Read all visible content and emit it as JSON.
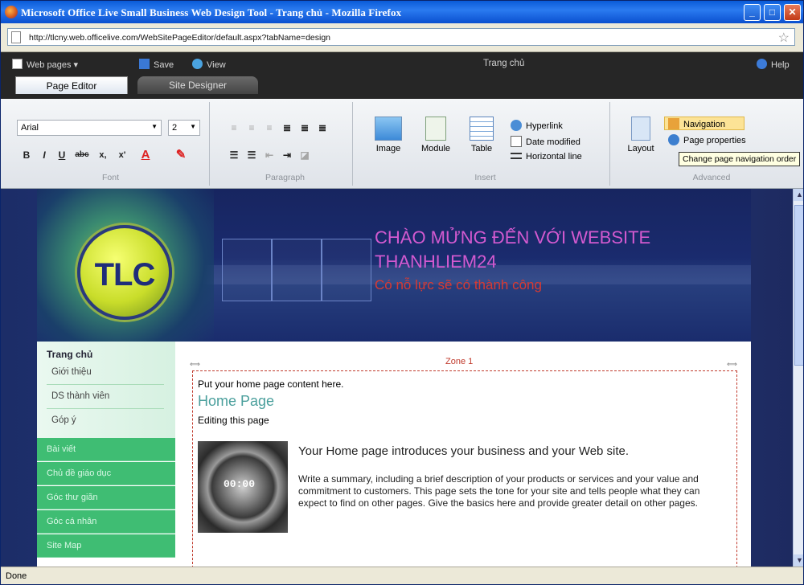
{
  "window": {
    "title": "Microsoft Office Live Small Business Web Design Tool - Trang chủ - Mozilla Firefox",
    "minimize": "_",
    "maximize": "□",
    "close": "✕"
  },
  "address": {
    "url": "http://tlcny.web.officelive.com/WebSitePageEditor/default.aspx?tabName=design",
    "star": "☆"
  },
  "toolbar": {
    "web_pages": "Web pages",
    "save": "Save",
    "view": "View",
    "page_title": "Trang chủ",
    "help": "Help"
  },
  "tabs": [
    "Page Editor",
    "Site Designer"
  ],
  "ribbon": {
    "font": {
      "family": "Arial",
      "size": "2",
      "label": "Font",
      "bold": "B",
      "italic": "I",
      "underline": "U",
      "strike": "abc",
      "subscript": "x,",
      "superscript": "x'",
      "font_color": "A"
    },
    "paragraph": {
      "label": "Paragraph"
    },
    "insert": {
      "label": "Insert",
      "image": "Image",
      "module": "Module",
      "table": "Table",
      "hyperlink": "Hyperlink",
      "date_modified": "Date modified",
      "horizontal_line": "Horizontal line"
    },
    "advanced": {
      "label": "Advanced",
      "layout": "Layout",
      "navigation": "Navigation",
      "page_properties": "Page properties",
      "tooltip": "Change page navigation order"
    }
  },
  "site": {
    "logo_text": "TLC",
    "welcome_line1": "CHÀO MỬNG ĐẾN VỚI WEBSITE",
    "welcome_line2": "THANHLIEM24",
    "slogan": "Có nỗ lực sẽ có thành công"
  },
  "nav": {
    "home": "Trang chủ",
    "sub": [
      "Giới thiệu",
      "DS thành viên",
      "Góp ý"
    ],
    "main": [
      "Bài viết",
      "Chủ đề giáo dục",
      "Góc thư giãn",
      "Góc cá nhân",
      "Site Map"
    ]
  },
  "zone": {
    "label": "Zone 1",
    "put_here": "Put your home page content here.",
    "heading": "Home Page",
    "editing": "Editing this page",
    "image_text": "00:00",
    "intro": "Your Home page introduces your business and your Web site.",
    "summary": "Write a summary, including a brief description of your products or services and your value and commitment to customers. This page sets the tone for your site and tells people what they can expect to find on other pages. Give the basics here and provide greater detail on other pages."
  },
  "status": "Done",
  "colors": {
    "accent": "#3fbd73",
    "banner": "#1a2b6e",
    "welcome": "#d35ad0",
    "slogan": "#d83a32"
  }
}
